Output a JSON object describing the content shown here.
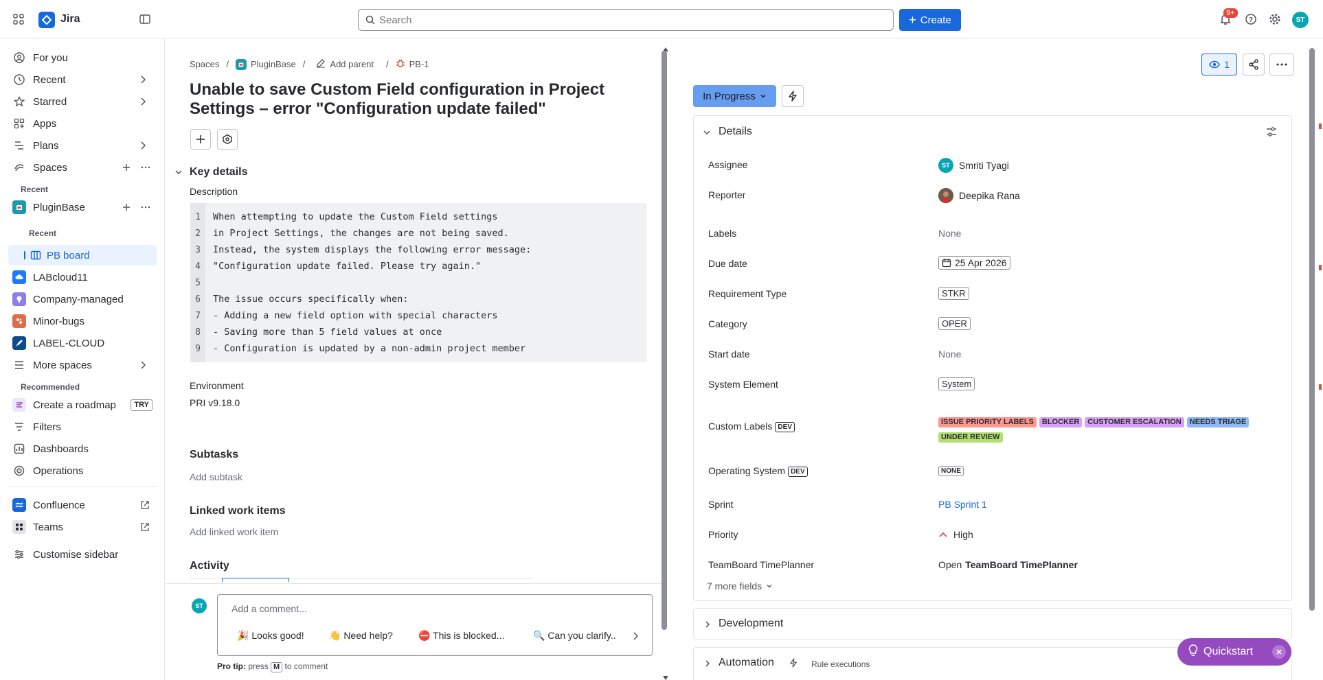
{
  "app": {
    "name": "Jira",
    "notifications": "9+",
    "user_initials": "ST"
  },
  "search": {
    "placeholder": "Search"
  },
  "toolbar": {
    "create_label": "Create"
  },
  "sidebar": {
    "for_you": "For you",
    "recent": "Recent",
    "starred": "Starred",
    "apps": "Apps",
    "plans": "Plans",
    "spaces": "Spaces",
    "recent_header": "Recent",
    "pluginbase": "PluginBase",
    "recent_sub": "Recent",
    "pb_board": "PB board",
    "labcloud": "LABcloud11",
    "company": "Company-managed",
    "minor": "Minor-bugs",
    "labelcloud": "LABEL-CLOUD",
    "more_spaces": "More spaces",
    "recommended": "Recommended",
    "roadmap": "Create a roadmap",
    "try": "TRY",
    "filters": "Filters",
    "dashboards": "Dashboards",
    "operations": "Operations",
    "confluence": "Confluence",
    "teams": "Teams",
    "customise": "Customise sidebar"
  },
  "breadcrumb": {
    "spaces": "Spaces",
    "project": "PluginBase",
    "add_parent": "Add parent",
    "issue_key": "PB-1"
  },
  "issue": {
    "title": "Unable to save Custom Field configuration in Project Settings – error \"Configuration update failed\"",
    "key_details": "Key details",
    "description_label": "Description",
    "description_lines": [
      {
        "n": "1",
        "t": "When attempting to update the Custom Field settings"
      },
      {
        "n": "2",
        "t": "in Project Settings, the changes are not being saved."
      },
      {
        "n": "3",
        "t": "Instead, the system displays the following error message:"
      },
      {
        "n": "4",
        "t": "\"Configuration update failed. Please try again.\""
      },
      {
        "n": "5",
        "t": ""
      },
      {
        "n": "6",
        "t": "The issue occurs specifically when:"
      },
      {
        "n": "7",
        "t": "- Adding a new field option with special characters"
      },
      {
        "n": "8",
        "t": "- Saving more than 5 field values at once"
      },
      {
        "n": "9",
        "t": "- Configuration is updated by a non-admin project member"
      }
    ],
    "environment_label": "Environment",
    "environment_value": "PRI v9.18.0",
    "subtasks": "Subtasks",
    "add_subtask": "Add subtask",
    "linked": "Linked work items",
    "add_linked": "Add linked work item",
    "activity": "Activity"
  },
  "comment": {
    "avatar": "ST",
    "placeholder": "Add a comment...",
    "chips": [
      "🎉 Looks good!",
      "👋 Need help?",
      "⛔ This is blocked...",
      "🔍 Can you clarify.."
    ],
    "protip_prefix": "Pro tip:",
    "protip_press": "press",
    "protip_key": "M",
    "protip_suffix": "to comment"
  },
  "actions": {
    "watch_count": "1"
  },
  "status": {
    "label": "In Progress"
  },
  "details": {
    "title": "Details",
    "assignee_label": "Assignee",
    "assignee": "Smriti Tyagi",
    "assignee_initials": "ST",
    "reporter_label": "Reporter",
    "reporter": "Deepika Rana",
    "labels_label": "Labels",
    "labels": "None",
    "due_label": "Due date",
    "due": "25 Apr 2026",
    "req_label": "Requirement Type",
    "req": "STKR",
    "category_label": "Category",
    "category": "OPER",
    "start_label": "Start date",
    "start": "None",
    "syselem_label": "System Element",
    "syselem": "System",
    "custom_label": "Custom Labels",
    "dev_tag": "DEV",
    "custom_labels": [
      {
        "text": "ISSUE PRIORITY LABELS",
        "color": "#fd9891"
      },
      {
        "text": "BLOCKER",
        "color": "#d8a0f7"
      },
      {
        "text": "CUSTOMER ESCALATION",
        "color": "#d8a0f7"
      },
      {
        "text": "NEEDS TRIAGE",
        "color": "#8fb8f6"
      },
      {
        "text": "UNDER REVIEW",
        "color": "#b3df72"
      }
    ],
    "os_label": "Operating System",
    "os": "NONE",
    "sprint_label": "Sprint",
    "sprint": "PB Sprint 1",
    "priority_label": "Priority",
    "priority": "High",
    "timeplanner_label": "TeamBoard TimePlanner",
    "timeplanner_open": "Open",
    "timeplanner": "TeamBoard TimePlanner",
    "more_fields": "7 more fields"
  },
  "sections": {
    "development": "Development",
    "automation": "Automation",
    "rule_exec": "Rule executions"
  },
  "quickstart": {
    "label": "Quickstart"
  },
  "colors": {
    "brand": "#1868db",
    "status": "#669df1",
    "quickstart": "#964ac0"
  }
}
